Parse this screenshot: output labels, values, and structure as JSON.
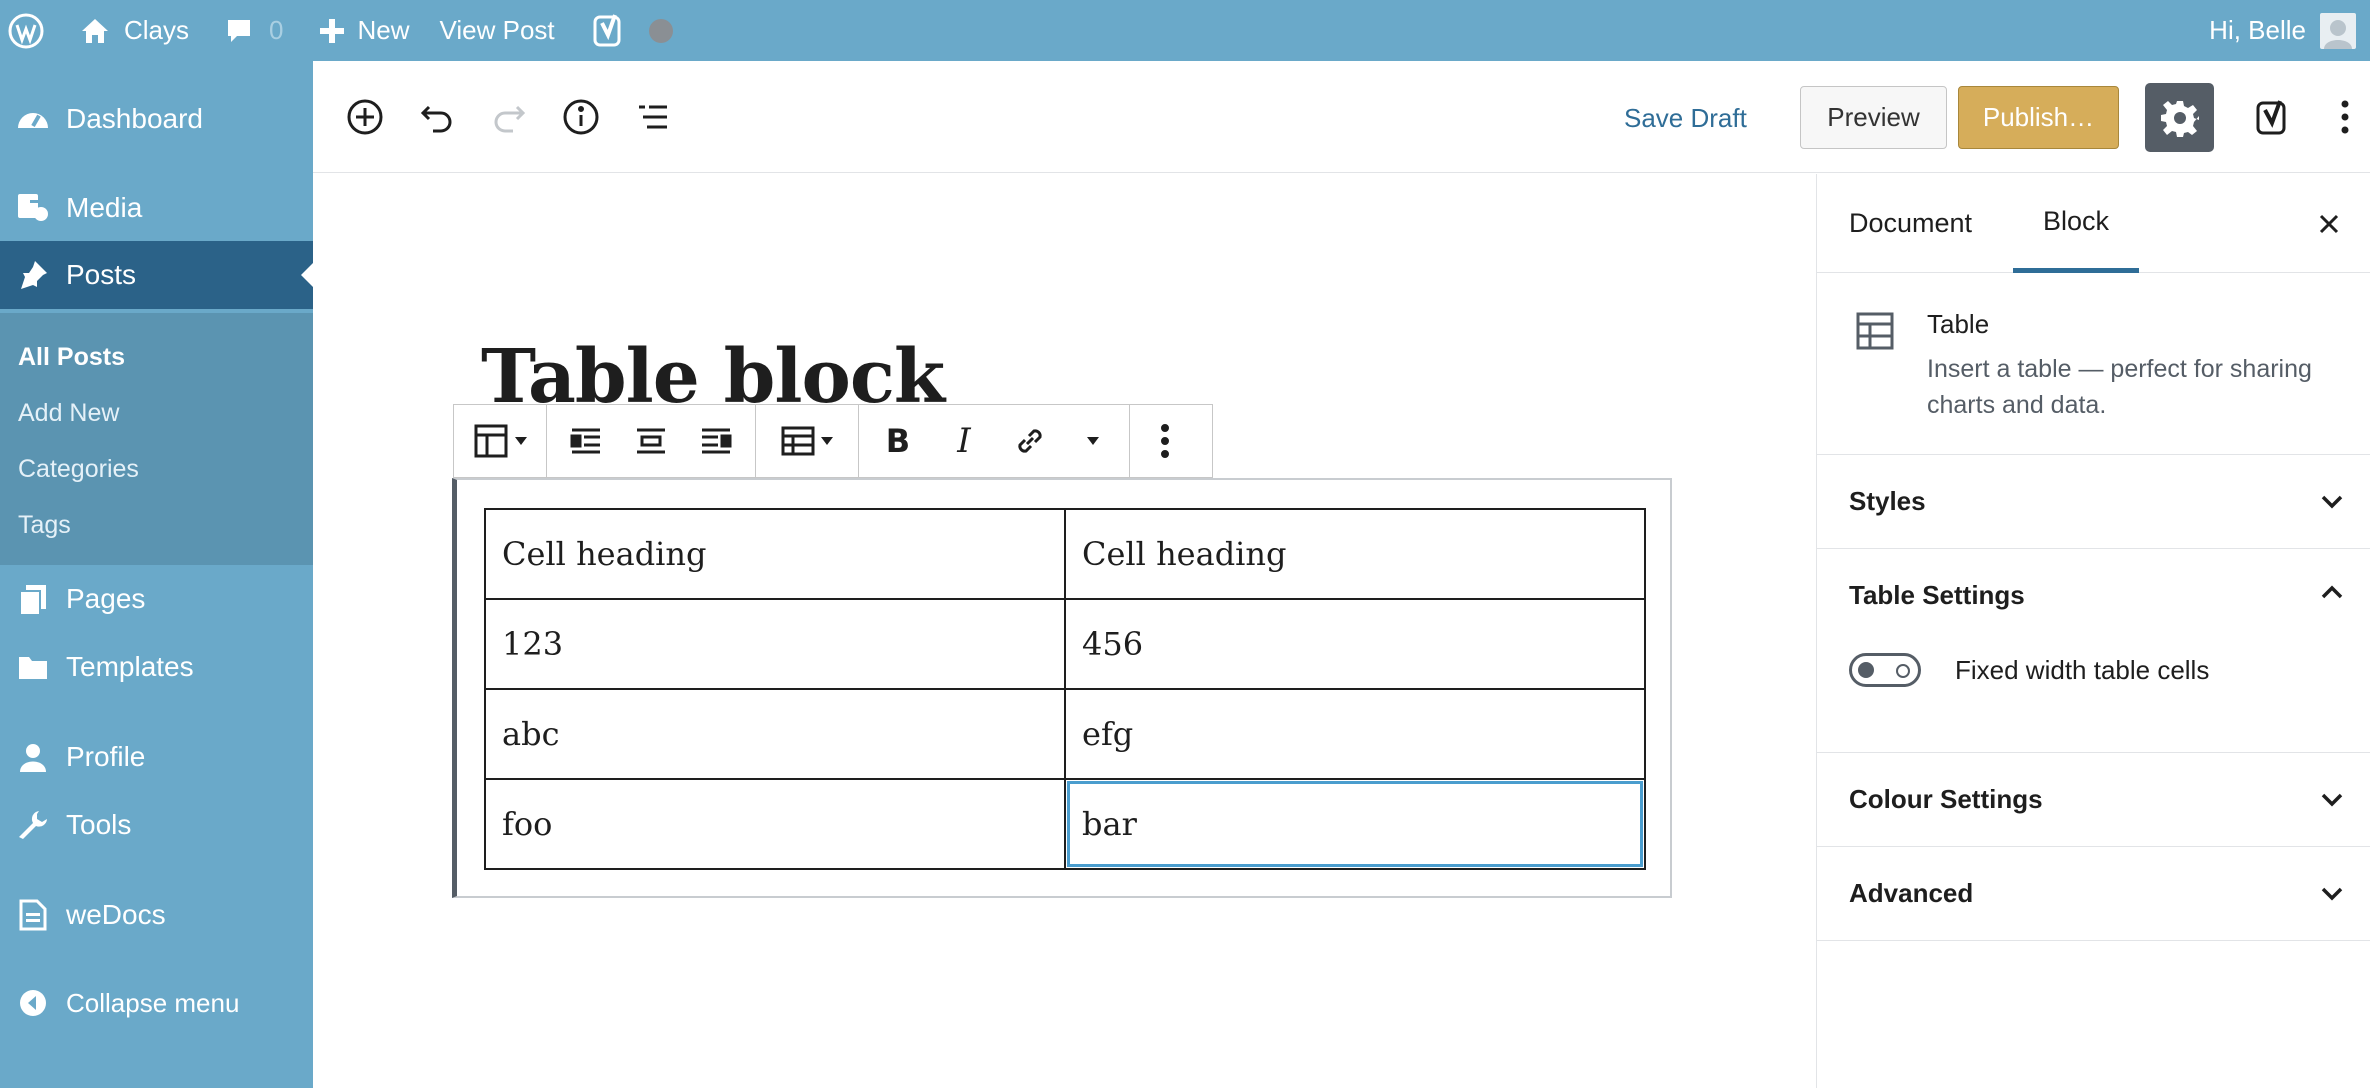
{
  "adminbar": {
    "site_name": "Clays",
    "comments_count": "0",
    "new_label": "New",
    "view_post_label": "View Post",
    "greeting": "Hi, Belle"
  },
  "sidebar": {
    "items": [
      {
        "label": "Dashboard",
        "icon": "dashboard-icon"
      },
      {
        "label": "Media",
        "icon": "media-icon"
      },
      {
        "label": "Posts",
        "icon": "pin-icon"
      },
      {
        "label": "Pages",
        "icon": "pages-icon"
      },
      {
        "label": "Templates",
        "icon": "folder-icon"
      },
      {
        "label": "Profile",
        "icon": "user-icon"
      },
      {
        "label": "Tools",
        "icon": "wrench-icon"
      },
      {
        "label": "weDocs",
        "icon": "document-icon"
      },
      {
        "label": "Collapse menu",
        "icon": "collapse-icon"
      }
    ],
    "submenu": [
      "All Posts",
      "Add New",
      "Categories",
      "Tags"
    ]
  },
  "toolbar": {
    "save_draft": "Save Draft",
    "preview": "Preview",
    "publish": "Publish…"
  },
  "editor": {
    "title": "Table block",
    "table": {
      "rows": [
        [
          "Cell heading",
          "Cell heading"
        ],
        [
          "123",
          "456"
        ],
        [
          "abc",
          "efg"
        ],
        [
          "foo",
          "bar"
        ]
      ]
    }
  },
  "panel": {
    "tabs": [
      "Document",
      "Block"
    ],
    "active_tab": "Block",
    "block_name": "Table",
    "block_description": "Insert a table — perfect for sharing charts and data.",
    "sections": {
      "styles": "Styles",
      "table_settings": "Table Settings",
      "fixed_width": "Fixed width table cells",
      "colour_settings": "Colour Settings",
      "advanced": "Advanced"
    }
  },
  "colors": {
    "admin_blue": "#6aa9c9",
    "current_menu": "#2b6288",
    "publish": "#d6ad5a",
    "link": "#2f6d97"
  }
}
